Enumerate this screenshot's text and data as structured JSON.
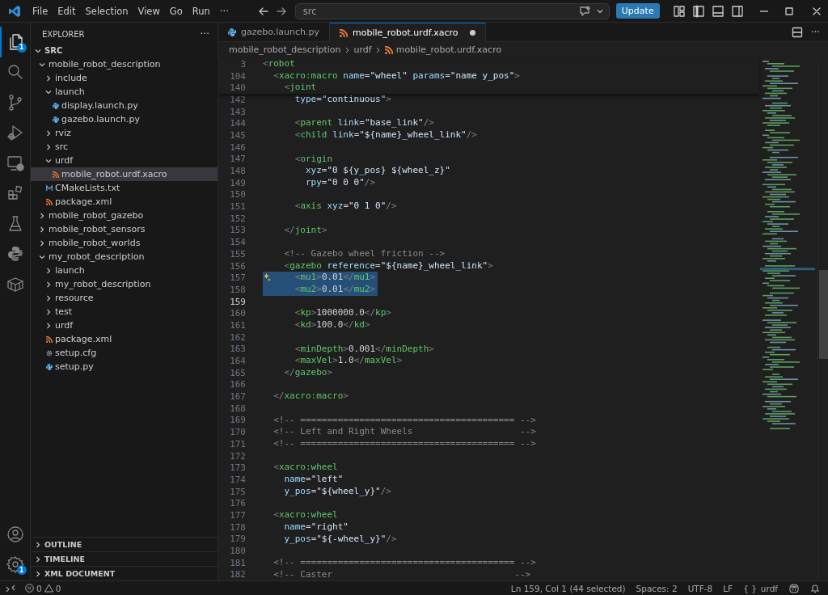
{
  "menu": [
    {
      "label": "File"
    },
    {
      "label": "Edit"
    },
    {
      "label": "Selection"
    },
    {
      "label": "View"
    },
    {
      "label": "Go"
    },
    {
      "label": "Run"
    },
    {
      "label": "···"
    }
  ],
  "command_center": {
    "value": "src"
  },
  "update_button": "Update",
  "activity_bar": {
    "top": [
      {
        "kind": "explorer",
        "badge": "1",
        "selected": true
      },
      {
        "kind": "search",
        "selected": false
      },
      {
        "kind": "source-control",
        "selected": false
      },
      {
        "kind": "run-debug",
        "selected": false
      },
      {
        "kind": "remote",
        "selected": false
      },
      {
        "kind": "extensions",
        "selected": false
      },
      {
        "kind": "testing",
        "selected": false
      },
      {
        "kind": "python",
        "selected": false
      },
      {
        "kind": "package",
        "selected": false
      }
    ],
    "bottom": [
      {
        "kind": "account"
      },
      {
        "kind": "settings",
        "badge": "1"
      }
    ]
  },
  "sidebar": {
    "title": "EXPLORER",
    "more": "···",
    "root": {
      "label": "SRC",
      "expanded": true
    },
    "tree": [
      {
        "label": "mobile_robot_description",
        "kind": "folder",
        "expanded": true,
        "selected": false,
        "children": [
          {
            "label": "include",
            "kind": "folder",
            "expanded": false,
            "selected": false
          },
          {
            "label": "launch",
            "kind": "folder",
            "expanded": true,
            "selected": false,
            "children": [
              {
                "label": "display.launch.py",
                "kind": "python",
                "selected": false
              },
              {
                "label": "gazebo.launch.py",
                "kind": "python",
                "selected": false
              }
            ]
          },
          {
            "label": "rviz",
            "kind": "folder",
            "expanded": false,
            "selected": false
          },
          {
            "label": "src",
            "kind": "folder",
            "expanded": false,
            "selected": false
          },
          {
            "label": "urdf",
            "kind": "folder",
            "expanded": true,
            "selected": false,
            "children": [
              {
                "label": "mobile_robot.urdf.xacro",
                "kind": "xml",
                "selected": true
              }
            ]
          },
          {
            "label": "CMakeLists.txt",
            "kind": "cmake",
            "selected": false
          },
          {
            "label": "package.xml",
            "kind": "xml",
            "selected": false
          }
        ]
      },
      {
        "label": "mobile_robot_gazebo",
        "kind": "folder",
        "expanded": false,
        "selected": false
      },
      {
        "label": "mobile_robot_sensors",
        "kind": "folder",
        "expanded": false,
        "selected": false
      },
      {
        "label": "mobile_robot_worlds",
        "kind": "folder",
        "expanded": false,
        "selected": false
      },
      {
        "label": "my_robot_description",
        "kind": "folder",
        "expanded": true,
        "selected": false,
        "children": [
          {
            "label": "launch",
            "kind": "folder",
            "expanded": false,
            "selected": false
          },
          {
            "label": "my_robot_description",
            "kind": "folder",
            "expanded": false,
            "selected": false
          },
          {
            "label": "resource",
            "kind": "folder",
            "expanded": false,
            "selected": false
          },
          {
            "label": "test",
            "kind": "folder",
            "expanded": false,
            "selected": false
          },
          {
            "label": "urdf",
            "kind": "folder",
            "expanded": false,
            "selected": false
          },
          {
            "label": "package.xml",
            "kind": "xml",
            "selected": false
          },
          {
            "label": "setup.cfg",
            "kind": "config",
            "selected": false
          },
          {
            "label": "setup.py",
            "kind": "python",
            "selected": false
          }
        ]
      }
    ],
    "panels": [
      {
        "label": "OUTLINE",
        "expanded": false
      },
      {
        "label": "TIMELINE",
        "expanded": false
      },
      {
        "label": "XML DOCUMENT",
        "expanded": false
      }
    ]
  },
  "tabs": [
    {
      "label": "gazebo.launch.py",
      "kind": "python",
      "selected": false,
      "modified": false
    },
    {
      "label": "mobile_robot.urdf.xacro",
      "kind": "xml",
      "selected": true,
      "modified": true
    }
  ],
  "editor_more": "···",
  "breadcrumb": [
    {
      "label": "mobile_robot_description"
    },
    {
      "label": "urdf"
    },
    {
      "label": "mobile_robot.urdf.xacro",
      "kind": "xml"
    }
  ],
  "sticky_lines": [
    {
      "number": "3",
      "code": "<robot"
    },
    {
      "number": "104",
      "code": "  <xacro:macro name=\"wheel\" params=\"name y_pos\">"
    },
    {
      "number": "140",
      "code": "    <joint"
    }
  ],
  "lines": [
    {
      "number": "142",
      "code": "      type=\"continuous\">",
      "selected": false,
      "current": false
    },
    {
      "number": "143",
      "selected": false,
      "current": false
    },
    {
      "number": "144",
      "code": "      <parent link=\"base_link\"/>",
      "selected": false,
      "current": false
    },
    {
      "number": "145",
      "code": "      <child link=\"${name}_wheel_link\"/>",
      "selected": false,
      "current": false
    },
    {
      "number": "146",
      "selected": false,
      "current": false
    },
    {
      "number": "147",
      "code": "      <origin",
      "selected": false,
      "current": false
    },
    {
      "number": "148",
      "code": "        xyz=\"0 ${y_pos} ${wheel_z}\"",
      "selected": false,
      "current": false
    },
    {
      "number": "149",
      "code": "        rpy=\"0 0 0\"/>",
      "selected": false,
      "current": false
    },
    {
      "number": "150",
      "selected": false,
      "current": false
    },
    {
      "number": "151",
      "code": "      <axis xyz=\"0 1 0\"/>",
      "selected": false,
      "current": false
    },
    {
      "number": "152",
      "selected": false,
      "current": false
    },
    {
      "number": "153",
      "code": "    </joint>",
      "selected": false,
      "current": false
    },
    {
      "number": "154",
      "selected": false,
      "current": false
    },
    {
      "number": "155",
      "code": "    <!-- Gazebo wheel friction -->",
      "selected": false,
      "current": false
    },
    {
      "number": "156",
      "code": "    <gazebo reference=\"${name}_wheel_link\">",
      "selected": false,
      "current": false
    },
    {
      "number": "157",
      "code": "      <mu1>0.01</mu1>",
      "selected": true,
      "current": false,
      "code_action": true
    },
    {
      "number": "158",
      "code": "      <mu2>0.01</mu2>",
      "selected": true,
      "current": false
    },
    {
      "number": "159",
      "selected": false,
      "current": true
    },
    {
      "number": "160",
      "code": "      <kp>1000000.0</kp>",
      "selected": false,
      "current": false
    },
    {
      "number": "161",
      "code": "      <kd>100.0</kd>",
      "selected": false,
      "current": false
    },
    {
      "number": "162",
      "selected": false,
      "current": false
    },
    {
      "number": "163",
      "code": "      <minDepth>0.001</minDepth>",
      "selected": false,
      "current": false
    },
    {
      "number": "164",
      "code": "      <maxVel>1.0</maxVel>",
      "selected": false,
      "current": false
    },
    {
      "number": "165",
      "code": "    </gazebo>",
      "selected": false,
      "current": false
    },
    {
      "number": "166",
      "selected": false,
      "current": false
    },
    {
      "number": "167",
      "code": "  </xacro:macro>",
      "selected": false,
      "current": false
    },
    {
      "number": "168",
      "selected": false,
      "current": false
    },
    {
      "number": "169",
      "code": "  <!-- ======================================== -->",
      "selected": false,
      "current": false
    },
    {
      "number": "170",
      "code": "  <!-- Left and Right Wheels                    -->",
      "selected": false,
      "current": false
    },
    {
      "number": "171",
      "code": "  <!-- ======================================== -->",
      "selected": false,
      "current": false
    },
    {
      "number": "172",
      "selected": false,
      "current": false
    },
    {
      "number": "173",
      "code": "  <xacro:wheel",
      "selected": false,
      "current": false
    },
    {
      "number": "174",
      "code": "    name=\"left\"",
      "selected": false,
      "current": false
    },
    {
      "number": "175",
      "code": "    y_pos=\"${wheel_y}\"/>",
      "selected": false,
      "current": false
    },
    {
      "number": "176",
      "selected": false,
      "current": false
    },
    {
      "number": "177",
      "code": "  <xacro:wheel",
      "selected": false,
      "current": false
    },
    {
      "number": "178",
      "code": "    name=\"right\"",
      "selected": false,
      "current": false
    },
    {
      "number": "179",
      "code": "    y_pos=\"${-wheel_y}\"/>",
      "selected": false,
      "current": false
    },
    {
      "number": "180",
      "selected": false,
      "current": false
    },
    {
      "number": "181",
      "code": "  <!-- ======================================== -->",
      "selected": false,
      "current": false
    },
    {
      "number": "182",
      "code": "  <!-- Caster                                  -->",
      "selected": false,
      "current": false
    }
  ],
  "status_bar": {
    "errors": "0",
    "warnings": "0",
    "items": [
      {
        "label": "Ln 159, Col 1 (44 selected)"
      },
      {
        "label": "Spaces: 2"
      },
      {
        "label": "UTF-8"
      },
      {
        "label": "LF"
      }
    ],
    "language_brace": "{ }",
    "language": "urdf"
  }
}
